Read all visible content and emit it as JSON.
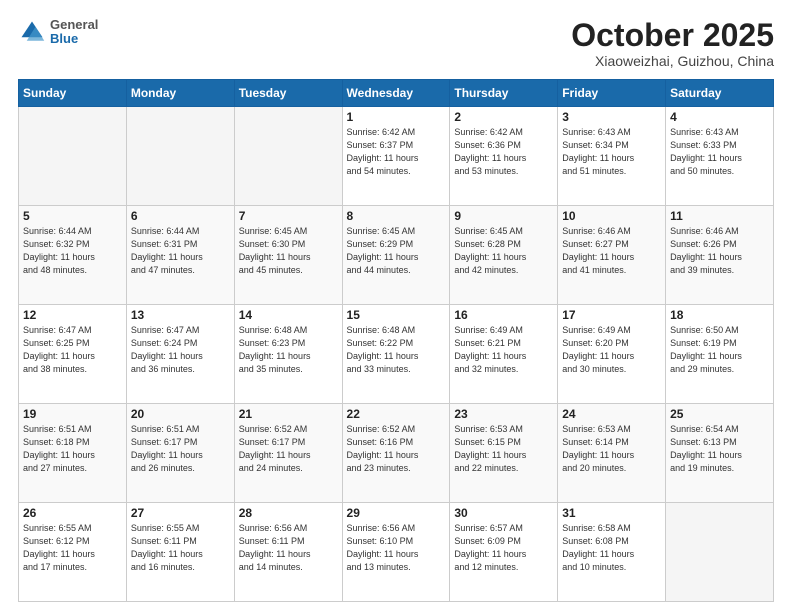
{
  "header": {
    "logo_general": "General",
    "logo_blue": "Blue",
    "title": "October 2025",
    "location": "Xiaoweizhai, Guizhou, China"
  },
  "weekdays": [
    "Sunday",
    "Monday",
    "Tuesday",
    "Wednesday",
    "Thursday",
    "Friday",
    "Saturday"
  ],
  "weeks": [
    [
      {
        "day": "",
        "info": ""
      },
      {
        "day": "",
        "info": ""
      },
      {
        "day": "",
        "info": ""
      },
      {
        "day": "1",
        "info": "Sunrise: 6:42 AM\nSunset: 6:37 PM\nDaylight: 11 hours\nand 54 minutes."
      },
      {
        "day": "2",
        "info": "Sunrise: 6:42 AM\nSunset: 6:36 PM\nDaylight: 11 hours\nand 53 minutes."
      },
      {
        "day": "3",
        "info": "Sunrise: 6:43 AM\nSunset: 6:34 PM\nDaylight: 11 hours\nand 51 minutes."
      },
      {
        "day": "4",
        "info": "Sunrise: 6:43 AM\nSunset: 6:33 PM\nDaylight: 11 hours\nand 50 minutes."
      }
    ],
    [
      {
        "day": "5",
        "info": "Sunrise: 6:44 AM\nSunset: 6:32 PM\nDaylight: 11 hours\nand 48 minutes."
      },
      {
        "day": "6",
        "info": "Sunrise: 6:44 AM\nSunset: 6:31 PM\nDaylight: 11 hours\nand 47 minutes."
      },
      {
        "day": "7",
        "info": "Sunrise: 6:45 AM\nSunset: 6:30 PM\nDaylight: 11 hours\nand 45 minutes."
      },
      {
        "day": "8",
        "info": "Sunrise: 6:45 AM\nSunset: 6:29 PM\nDaylight: 11 hours\nand 44 minutes."
      },
      {
        "day": "9",
        "info": "Sunrise: 6:45 AM\nSunset: 6:28 PM\nDaylight: 11 hours\nand 42 minutes."
      },
      {
        "day": "10",
        "info": "Sunrise: 6:46 AM\nSunset: 6:27 PM\nDaylight: 11 hours\nand 41 minutes."
      },
      {
        "day": "11",
        "info": "Sunrise: 6:46 AM\nSunset: 6:26 PM\nDaylight: 11 hours\nand 39 minutes."
      }
    ],
    [
      {
        "day": "12",
        "info": "Sunrise: 6:47 AM\nSunset: 6:25 PM\nDaylight: 11 hours\nand 38 minutes."
      },
      {
        "day": "13",
        "info": "Sunrise: 6:47 AM\nSunset: 6:24 PM\nDaylight: 11 hours\nand 36 minutes."
      },
      {
        "day": "14",
        "info": "Sunrise: 6:48 AM\nSunset: 6:23 PM\nDaylight: 11 hours\nand 35 minutes."
      },
      {
        "day": "15",
        "info": "Sunrise: 6:48 AM\nSunset: 6:22 PM\nDaylight: 11 hours\nand 33 minutes."
      },
      {
        "day": "16",
        "info": "Sunrise: 6:49 AM\nSunset: 6:21 PM\nDaylight: 11 hours\nand 32 minutes."
      },
      {
        "day": "17",
        "info": "Sunrise: 6:49 AM\nSunset: 6:20 PM\nDaylight: 11 hours\nand 30 minutes."
      },
      {
        "day": "18",
        "info": "Sunrise: 6:50 AM\nSunset: 6:19 PM\nDaylight: 11 hours\nand 29 minutes."
      }
    ],
    [
      {
        "day": "19",
        "info": "Sunrise: 6:51 AM\nSunset: 6:18 PM\nDaylight: 11 hours\nand 27 minutes."
      },
      {
        "day": "20",
        "info": "Sunrise: 6:51 AM\nSunset: 6:17 PM\nDaylight: 11 hours\nand 26 minutes."
      },
      {
        "day": "21",
        "info": "Sunrise: 6:52 AM\nSunset: 6:17 PM\nDaylight: 11 hours\nand 24 minutes."
      },
      {
        "day": "22",
        "info": "Sunrise: 6:52 AM\nSunset: 6:16 PM\nDaylight: 11 hours\nand 23 minutes."
      },
      {
        "day": "23",
        "info": "Sunrise: 6:53 AM\nSunset: 6:15 PM\nDaylight: 11 hours\nand 22 minutes."
      },
      {
        "day": "24",
        "info": "Sunrise: 6:53 AM\nSunset: 6:14 PM\nDaylight: 11 hours\nand 20 minutes."
      },
      {
        "day": "25",
        "info": "Sunrise: 6:54 AM\nSunset: 6:13 PM\nDaylight: 11 hours\nand 19 minutes."
      }
    ],
    [
      {
        "day": "26",
        "info": "Sunrise: 6:55 AM\nSunset: 6:12 PM\nDaylight: 11 hours\nand 17 minutes."
      },
      {
        "day": "27",
        "info": "Sunrise: 6:55 AM\nSunset: 6:11 PM\nDaylight: 11 hours\nand 16 minutes."
      },
      {
        "day": "28",
        "info": "Sunrise: 6:56 AM\nSunset: 6:11 PM\nDaylight: 11 hours\nand 14 minutes."
      },
      {
        "day": "29",
        "info": "Sunrise: 6:56 AM\nSunset: 6:10 PM\nDaylight: 11 hours\nand 13 minutes."
      },
      {
        "day": "30",
        "info": "Sunrise: 6:57 AM\nSunset: 6:09 PM\nDaylight: 11 hours\nand 12 minutes."
      },
      {
        "day": "31",
        "info": "Sunrise: 6:58 AM\nSunset: 6:08 PM\nDaylight: 11 hours\nand 10 minutes."
      },
      {
        "day": "",
        "info": ""
      }
    ]
  ]
}
